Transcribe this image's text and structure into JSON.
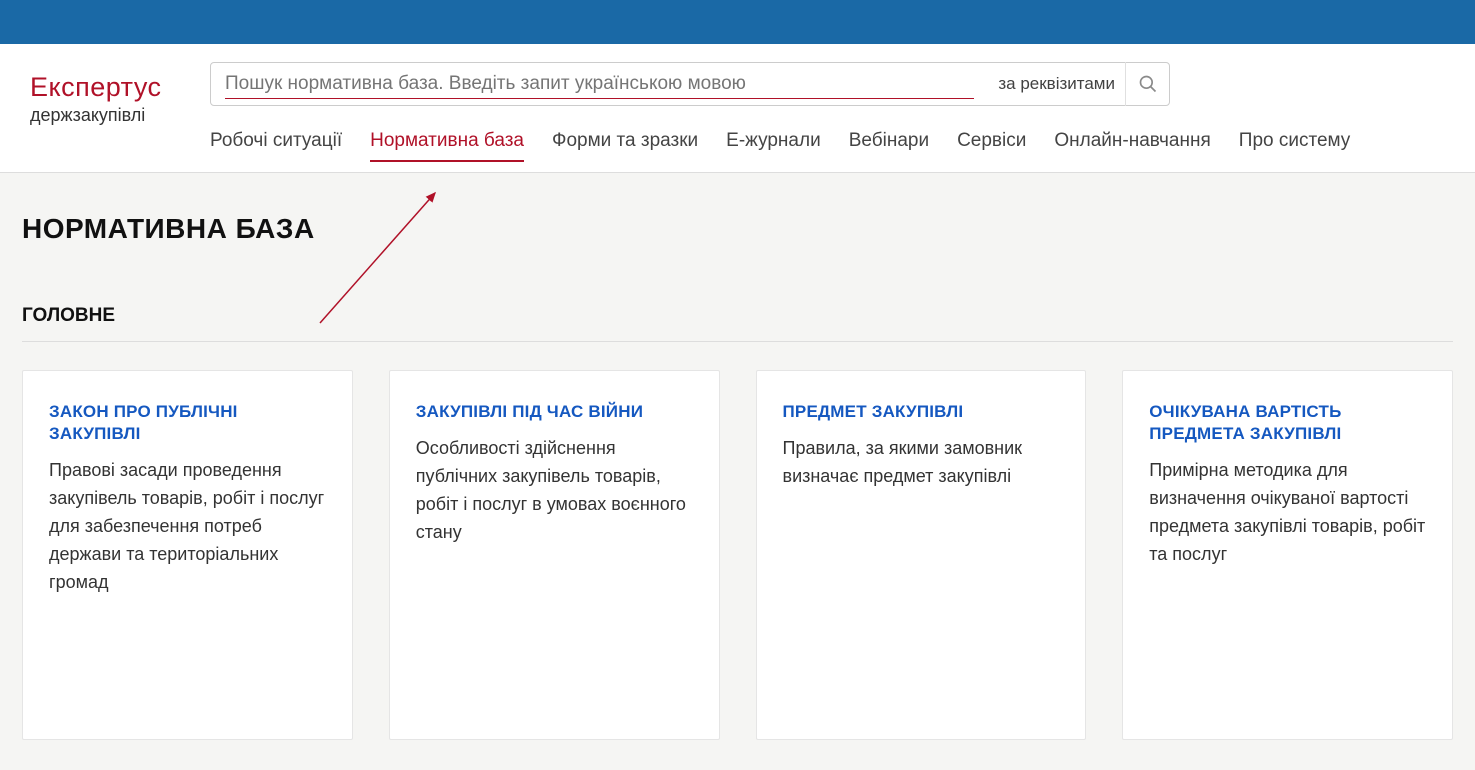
{
  "logo": {
    "line1": "Експертус",
    "line2": "держзакупівлі"
  },
  "search": {
    "placeholder": "Пошук нормативна база. Введіть запит українською мовою",
    "by_requisites": "за реквізитами"
  },
  "nav": {
    "items": [
      {
        "label": "Робочі ситуації",
        "active": false
      },
      {
        "label": "Нормативна база",
        "active": true
      },
      {
        "label": "Форми та зразки",
        "active": false
      },
      {
        "label": "Е-журнали",
        "active": false
      },
      {
        "label": "Вебінари",
        "active": false
      },
      {
        "label": "Сервіси",
        "active": false
      },
      {
        "label": "Онлайн-навчання",
        "active": false
      },
      {
        "label": "Про систему",
        "active": false
      }
    ]
  },
  "page": {
    "title": "НОРМАТИВНА БАЗА",
    "section": "ГОЛОВНЕ"
  },
  "cards": [
    {
      "title": "ЗАКОН ПРО ПУБЛІЧНІ ЗАКУПІВЛІ",
      "desc": "Правові засади проведення закупівель товарів, робіт і послуг для забезпечення потреб держави та територіальних громад"
    },
    {
      "title": "ЗАКУПІВЛІ ПІД ЧАС ВІЙНИ",
      "desc": "Особливості здійснення публічних закупівель товарів, робіт і послуг в умовах воєнного стану"
    },
    {
      "title": "ПРЕДМЕТ ЗАКУПІВЛІ",
      "desc": "Правила, за якими замовник визначає предмет закупівлі"
    },
    {
      "title": "ОЧІКУВАНА ВАРТІСТЬ ПРЕДМЕТА ЗАКУПІВЛІ",
      "desc": "Примірна методика для визначення очікуваної вартості предмета закупівлі товарів, робіт та послуг"
    }
  ]
}
